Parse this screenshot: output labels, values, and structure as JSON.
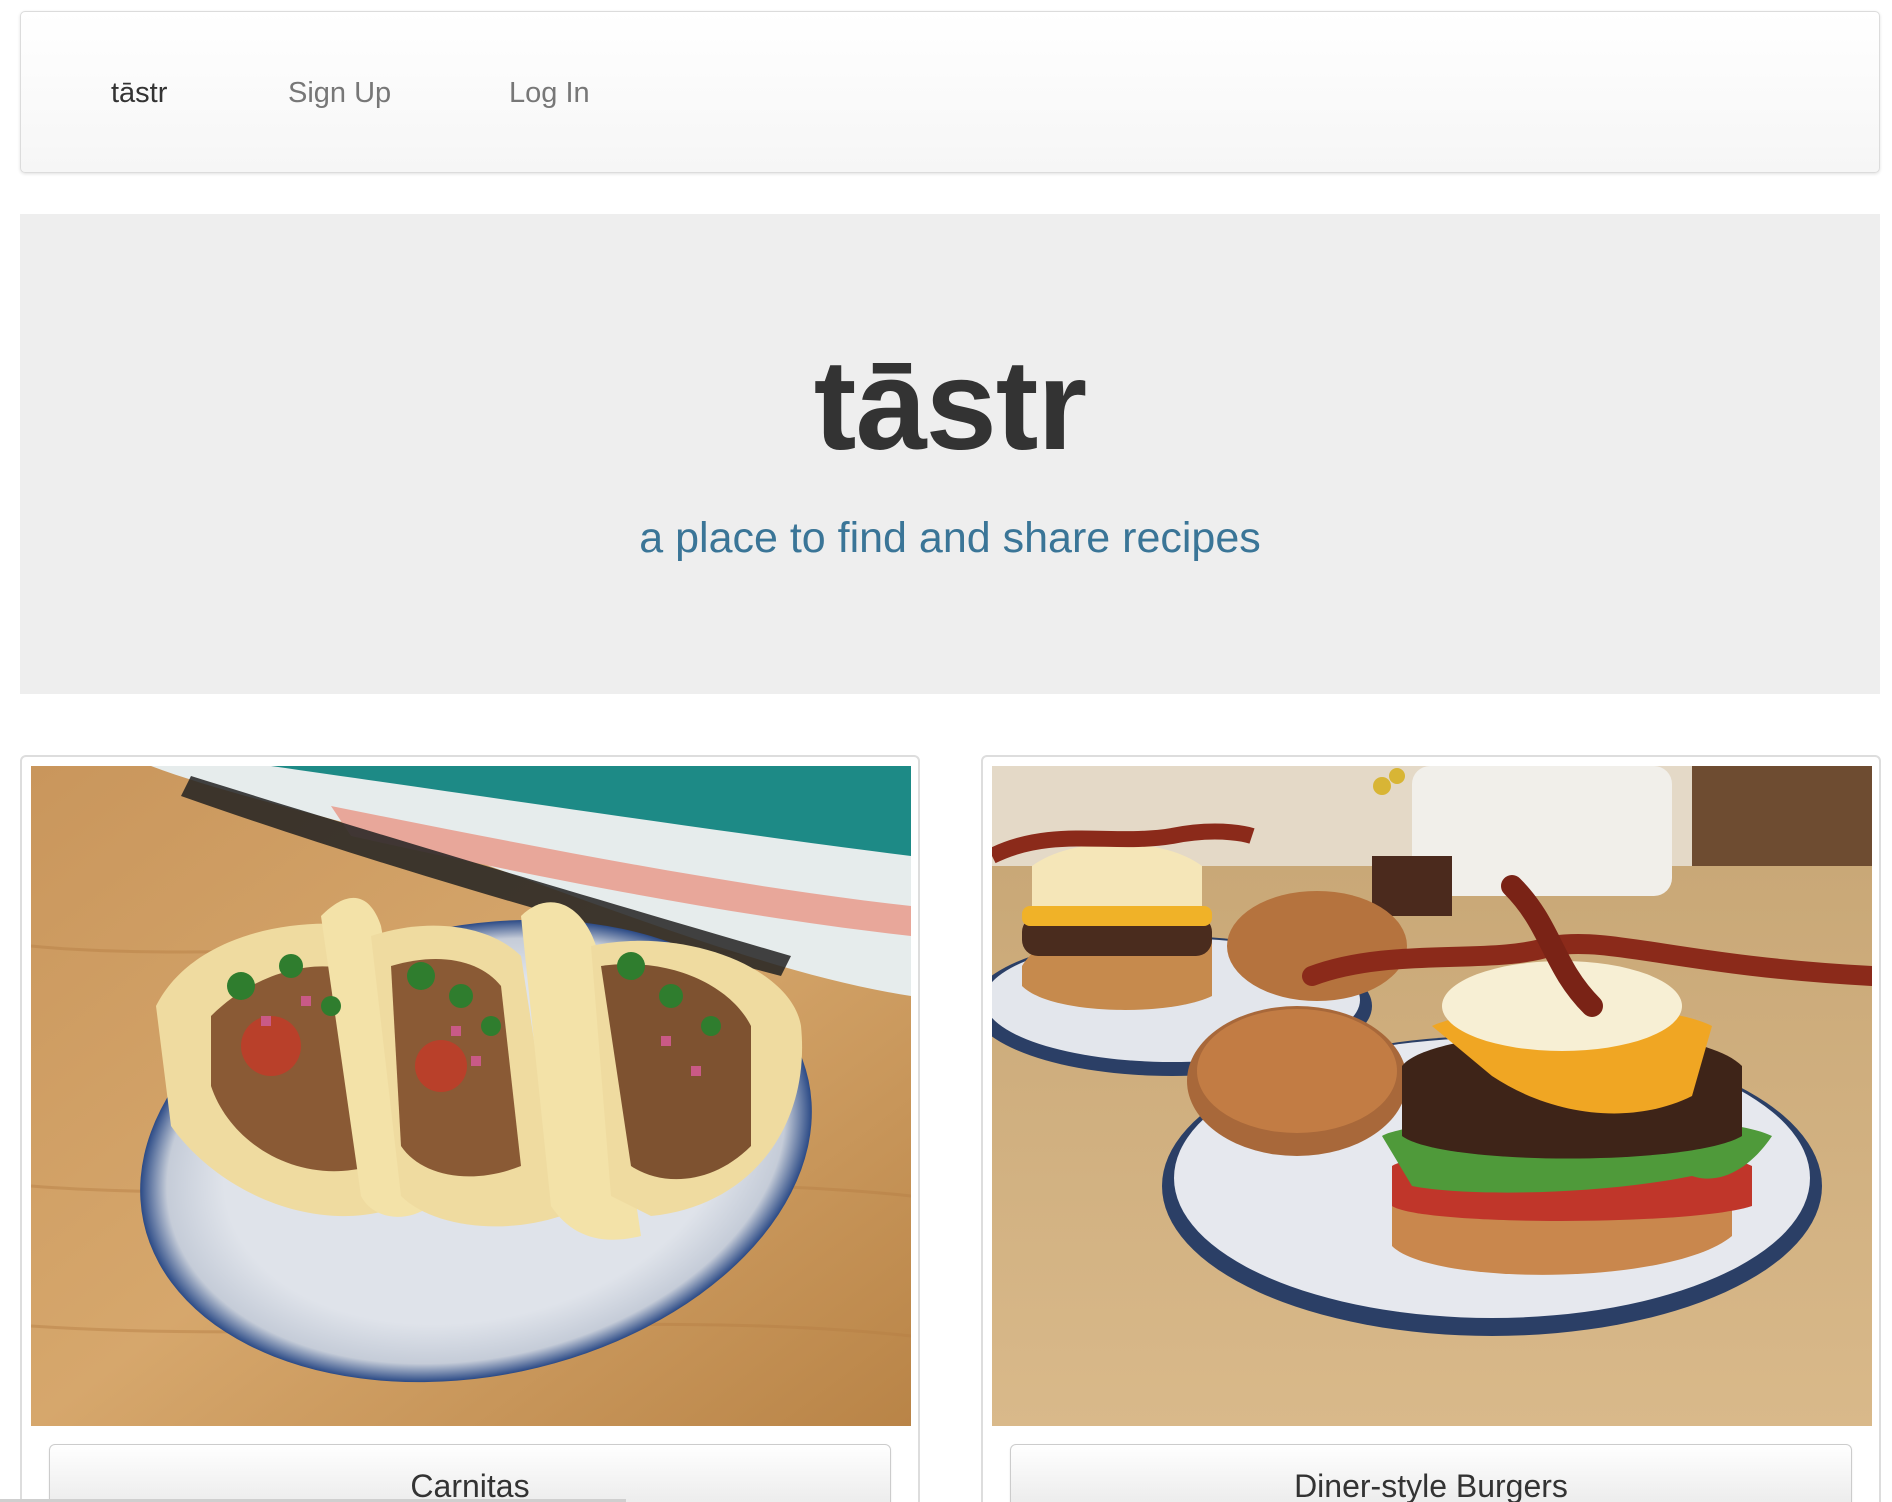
{
  "navbar": {
    "brand": "tāstr",
    "links": [
      "Sign Up",
      "Log In"
    ]
  },
  "hero": {
    "title": "tāstr",
    "subtitle": "a place to find and share recipes"
  },
  "recipes": [
    {
      "title": "Carnitas",
      "image": "tacos-photo"
    },
    {
      "title": "Diner-style Burgers",
      "image": "burgers-photo"
    }
  ],
  "colors": {
    "hero_bg": "#eeeeee",
    "subtitle": "#3a7597",
    "navbar_bg": "#f8f8f8"
  }
}
